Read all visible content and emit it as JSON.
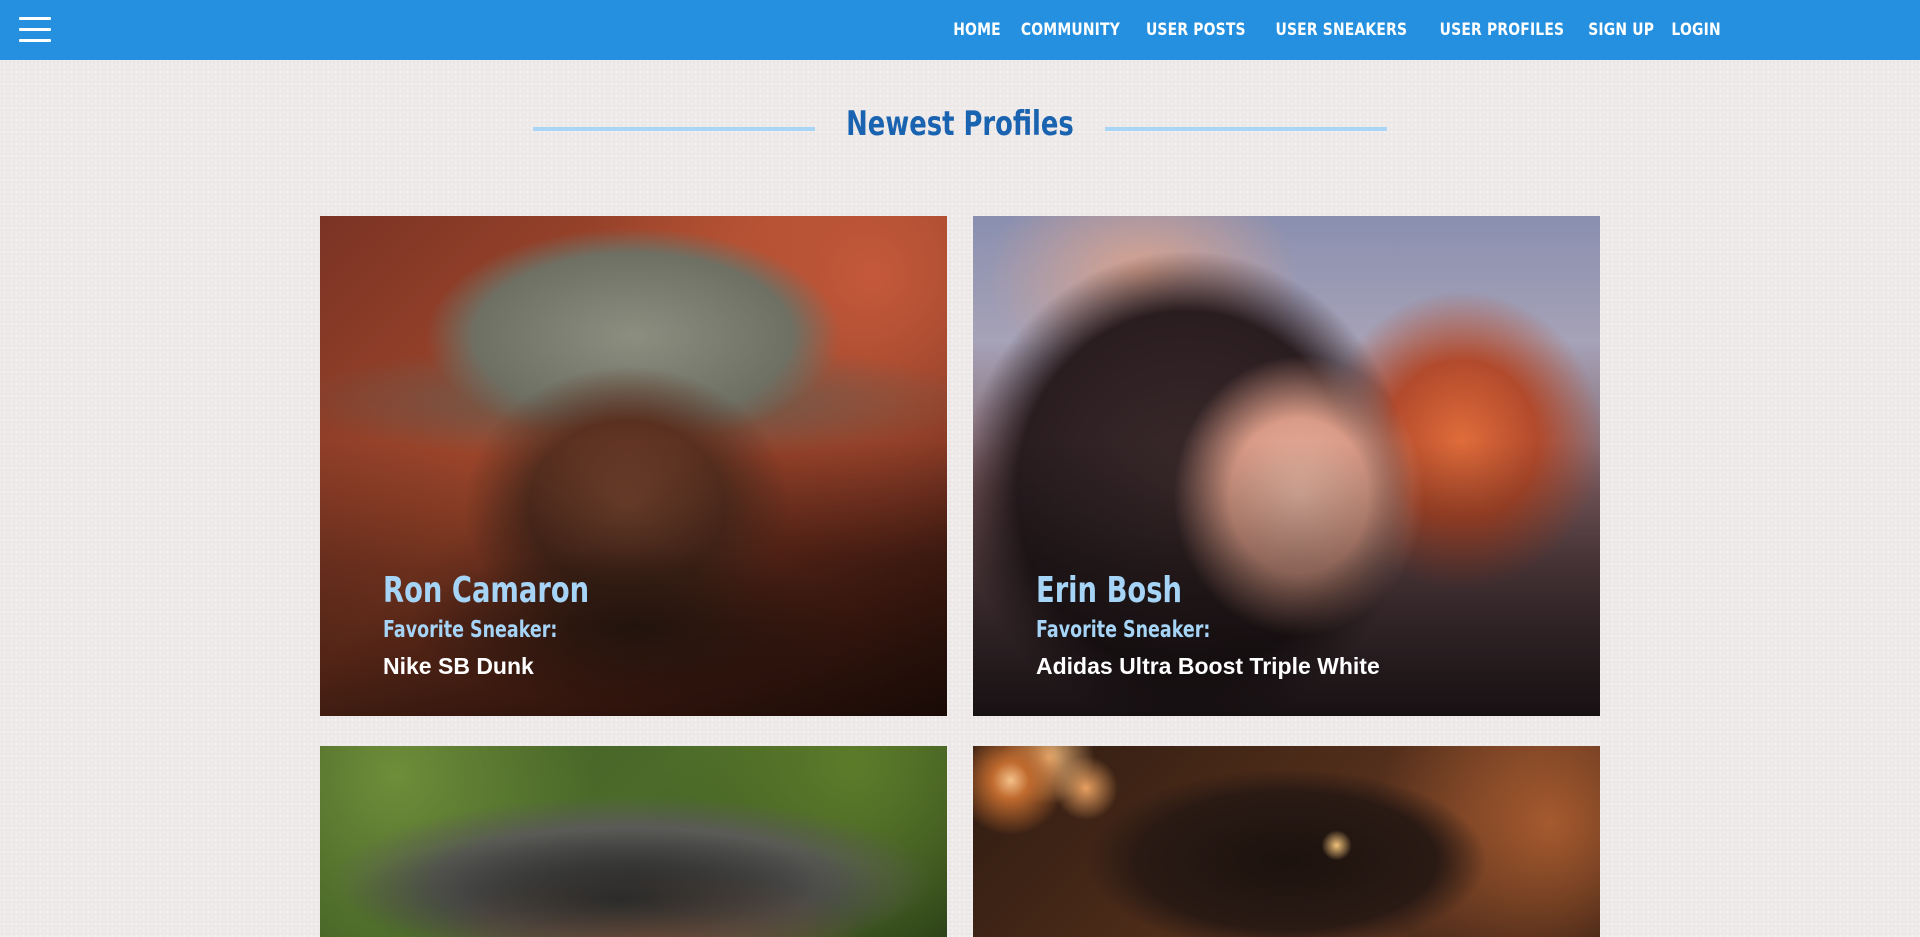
{
  "nav": {
    "menu_icon": "hamburger-menu-icon",
    "links": [
      {
        "label": "HOME"
      },
      {
        "label": "COMMUNITY"
      },
      {
        "label": "USER POSTS"
      },
      {
        "label": "USER SNEAKERS"
      },
      {
        "label": "USER PROFILES"
      },
      {
        "label": "SIGN UP"
      },
      {
        "label": "LOGIN"
      }
    ]
  },
  "section": {
    "title": "Newest Profiles"
  },
  "profiles": [
    {
      "name": "Ron Camaron",
      "favorite_label": "Favorite Sneaker:",
      "sneaker": "Nike SB Dunk"
    },
    {
      "name": "Erin Bosh",
      "favorite_label": "Favorite Sneaker:",
      "sneaker": "Adidas Ultra Boost Triple White"
    },
    {
      "name": "",
      "favorite_label": "",
      "sneaker": ""
    },
    {
      "name": "",
      "favorite_label": "",
      "sneaker": ""
    }
  ],
  "colors": {
    "navbar": "#2490df",
    "accent_text": "#a6d4f7",
    "section_title": "#1a63b0",
    "divider": "#a9d6f6",
    "page_bg": "#efebea"
  }
}
